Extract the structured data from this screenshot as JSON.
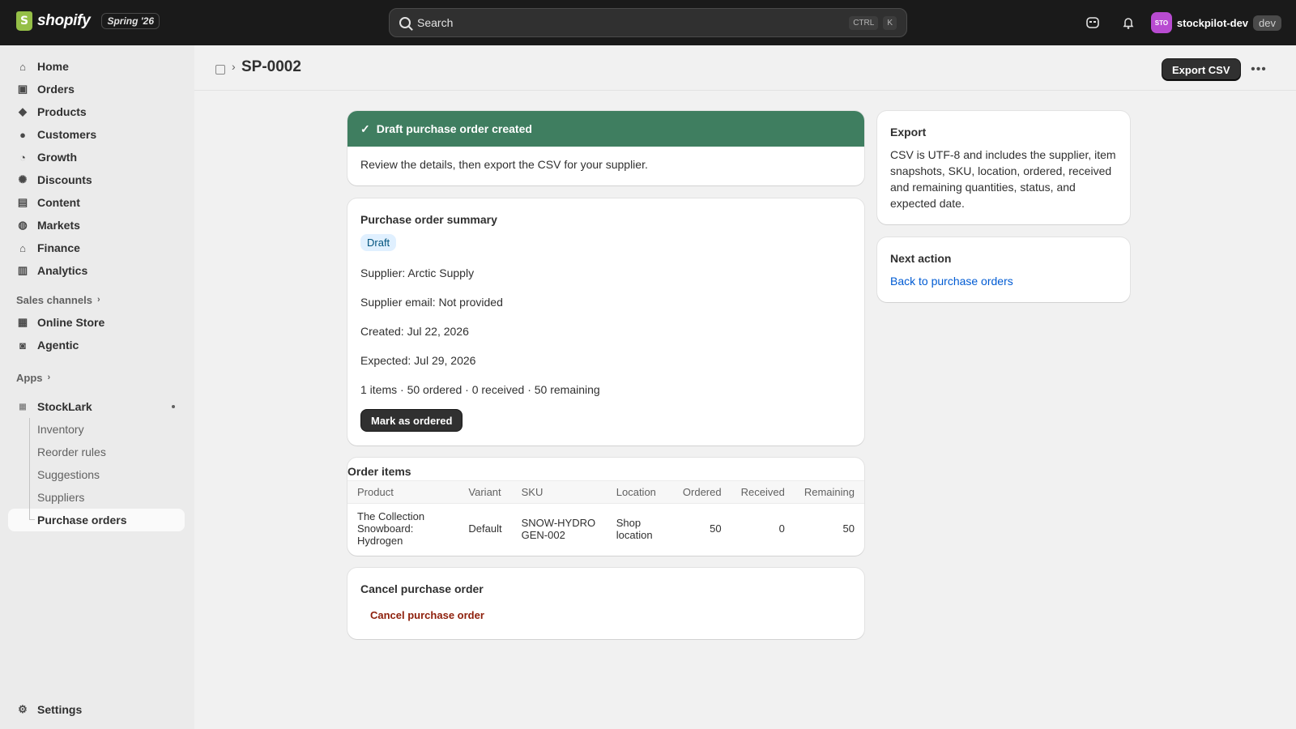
{
  "topbar": {
    "logo_text": "shopify",
    "edition_badge": "Spring '26",
    "search_placeholder": "Search",
    "shortcut_ctrl": "CTRL",
    "shortcut_key": "K",
    "avatar_initials": "STO",
    "store_name": "stockpilot-dev",
    "env_badge": "dev"
  },
  "sidebar": {
    "main_items": [
      {
        "label": "Home",
        "icon": "home-icon"
      },
      {
        "label": "Orders",
        "icon": "orders-icon"
      },
      {
        "label": "Products",
        "icon": "tag-icon"
      },
      {
        "label": "Customers",
        "icon": "person-icon"
      },
      {
        "label": "Growth",
        "icon": "growth-icon"
      },
      {
        "label": "Discounts",
        "icon": "discount-icon"
      },
      {
        "label": "Content",
        "icon": "content-icon"
      },
      {
        "label": "Markets",
        "icon": "globe-icon"
      },
      {
        "label": "Finance",
        "icon": "bank-icon"
      },
      {
        "label": "Analytics",
        "icon": "chart-icon"
      }
    ],
    "sales_channels_label": "Sales channels",
    "channels": [
      {
        "label": "Online Store",
        "icon": "store-icon"
      },
      {
        "label": "Agentic",
        "icon": "agentic-icon"
      }
    ],
    "apps_label": "Apps",
    "app_name": "StockLark",
    "app_subitems": [
      "Inventory",
      "Reorder rules",
      "Suggestions",
      "Suppliers",
      "Purchase orders"
    ],
    "settings_label": "Settings"
  },
  "header": {
    "title": "SP-0002",
    "export_label": "Export CSV"
  },
  "banner": {
    "title": "Draft purchase order created",
    "body": "Review the details, then export the CSV for your supplier."
  },
  "summary": {
    "title": "Purchase order summary",
    "status": "Draft",
    "supplier": "Supplier: Arctic Supply",
    "supplier_email": "Supplier email: Not provided",
    "created": "Created: Jul 22, 2026",
    "expected": "Expected: Jul 29, 2026",
    "totals": "1 items · 50 ordered · 0 received · 50 remaining",
    "action_label": "Mark as ordered"
  },
  "order_items": {
    "title": "Order items",
    "columns": [
      "Product",
      "Variant",
      "SKU",
      "Location",
      "Ordered",
      "Received",
      "Remaining"
    ],
    "rows": [
      {
        "product": "The Collection Snowboard: Hydrogen",
        "variant": "Default",
        "sku": "SNOW-HYDROGEN-002",
        "location": "Shop location",
        "ordered": "50",
        "received": "0",
        "remaining": "50"
      }
    ]
  },
  "cancel": {
    "title": "Cancel purchase order",
    "action_label": "Cancel purchase order"
  },
  "export_card": {
    "title": "Export",
    "body": "CSV is UTF-8 and includes the supplier, item snapshots, SKU, location, ordered, received and remaining quantities, status, and expected date."
  },
  "next_action": {
    "title": "Next action",
    "link_label": "Back to purchase orders"
  },
  "colors": {
    "banner_green": "#3f7e60",
    "link_blue": "#005bd3",
    "danger_red": "#8e1f0b",
    "avatar_purple": "#b84bd1"
  }
}
